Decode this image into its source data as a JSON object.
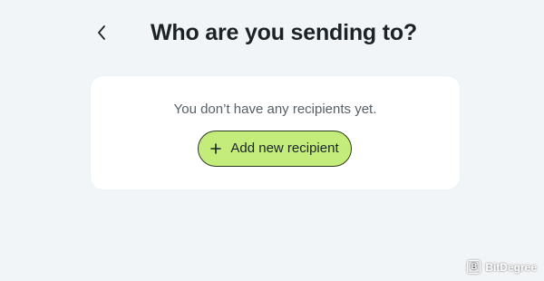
{
  "header": {
    "back_icon": "chevron-left-icon",
    "title": "Who are you sending to?"
  },
  "recipients": {
    "empty_message": "You don’t have any recipients yet.",
    "add_button": {
      "icon": "plus-icon",
      "label": "Add new recipient",
      "color": "#c4ec7a"
    }
  },
  "watermark": {
    "logo_glyph": "B",
    "text": "BitDegree"
  },
  "colors": {
    "background": "#f2f5f7",
    "card": "#ffffff",
    "accent": "#c4ec7a"
  }
}
